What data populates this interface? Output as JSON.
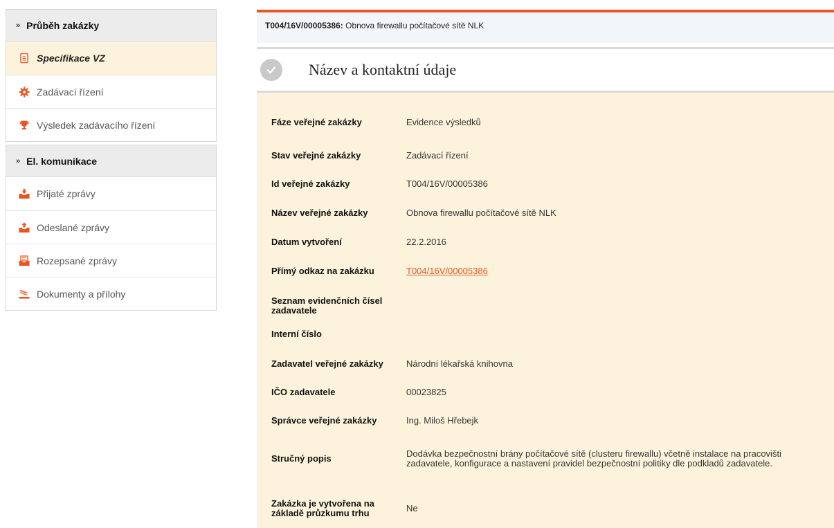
{
  "sidebar": {
    "progress": {
      "title": "Průběh zakázky",
      "items": [
        {
          "label": "Specifikace VZ",
          "icon": "document-icon"
        },
        {
          "label": "Zadávací řízení",
          "icon": "gear-icon"
        },
        {
          "label": "Výsledek zadávacího řízení",
          "icon": "trophy-icon"
        }
      ]
    },
    "communication": {
      "title": "El. komunikace",
      "items": [
        {
          "label": "Přijaté zprávy",
          "icon": "inbox-icon"
        },
        {
          "label": "Odeslané zprávy",
          "icon": "outbox-icon"
        },
        {
          "label": "Rozepsané zprávy",
          "icon": "drafts-icon"
        },
        {
          "label": "Dokumenty a přílohy",
          "icon": "documents-icon"
        }
      ]
    }
  },
  "header": {
    "code": "T004/16V/00005386:",
    "title": "Obnova firewallu počítačové sítě NLK"
  },
  "section": {
    "title": "Název a kontaktní údaje",
    "icon": "check-circle-icon"
  },
  "details": [
    {
      "label": "Fáze veřejné zakázky",
      "value": "Evidence výsledků"
    },
    {
      "label": "Stav veřejné zakázky",
      "value": "Zadávací řízení"
    },
    {
      "label": "Id veřejné zakázky",
      "value": "T004/16V/00005386"
    },
    {
      "label": "Název veřejné zakázky",
      "value": "Obnova firewallu počítačové sítě NLK"
    },
    {
      "label": "Datum vytvoření",
      "value": "22.2.2016"
    },
    {
      "label": "Přímý odkaz na zakázku",
      "value": "T004/16V/00005386"
    },
    {
      "label": "Seznam evidenčních čísel zadavatele",
      "value": ""
    },
    {
      "label": "Interní číslo",
      "value": ""
    },
    {
      "label": "Zadavatel veřejné zakázky",
      "value": "Národní lékařská knihovna"
    },
    {
      "label": "IČO zadavatele",
      "value": "00023825"
    },
    {
      "label": "Správce veřejné zakázky",
      "value": "Ing. Miloš Hřebejk"
    },
    {
      "label": "Stručný popis",
      "value": "Dodávka bezpečnostní brány počítačové sítě (clusteru firewallu) včetně instalace na pracovišti zadavatele, konfigurace a nastavení pravidel bezpečnostní politiky dle podkladů zadavatele."
    },
    {
      "label": "Zakázka je vytvořena na základě průzkumu trhu",
      "value": "Ne"
    }
  ],
  "colors": {
    "accent": "#e8551e",
    "active_bg": "#fdf3dc",
    "details_bg": "#fdf3dc"
  }
}
